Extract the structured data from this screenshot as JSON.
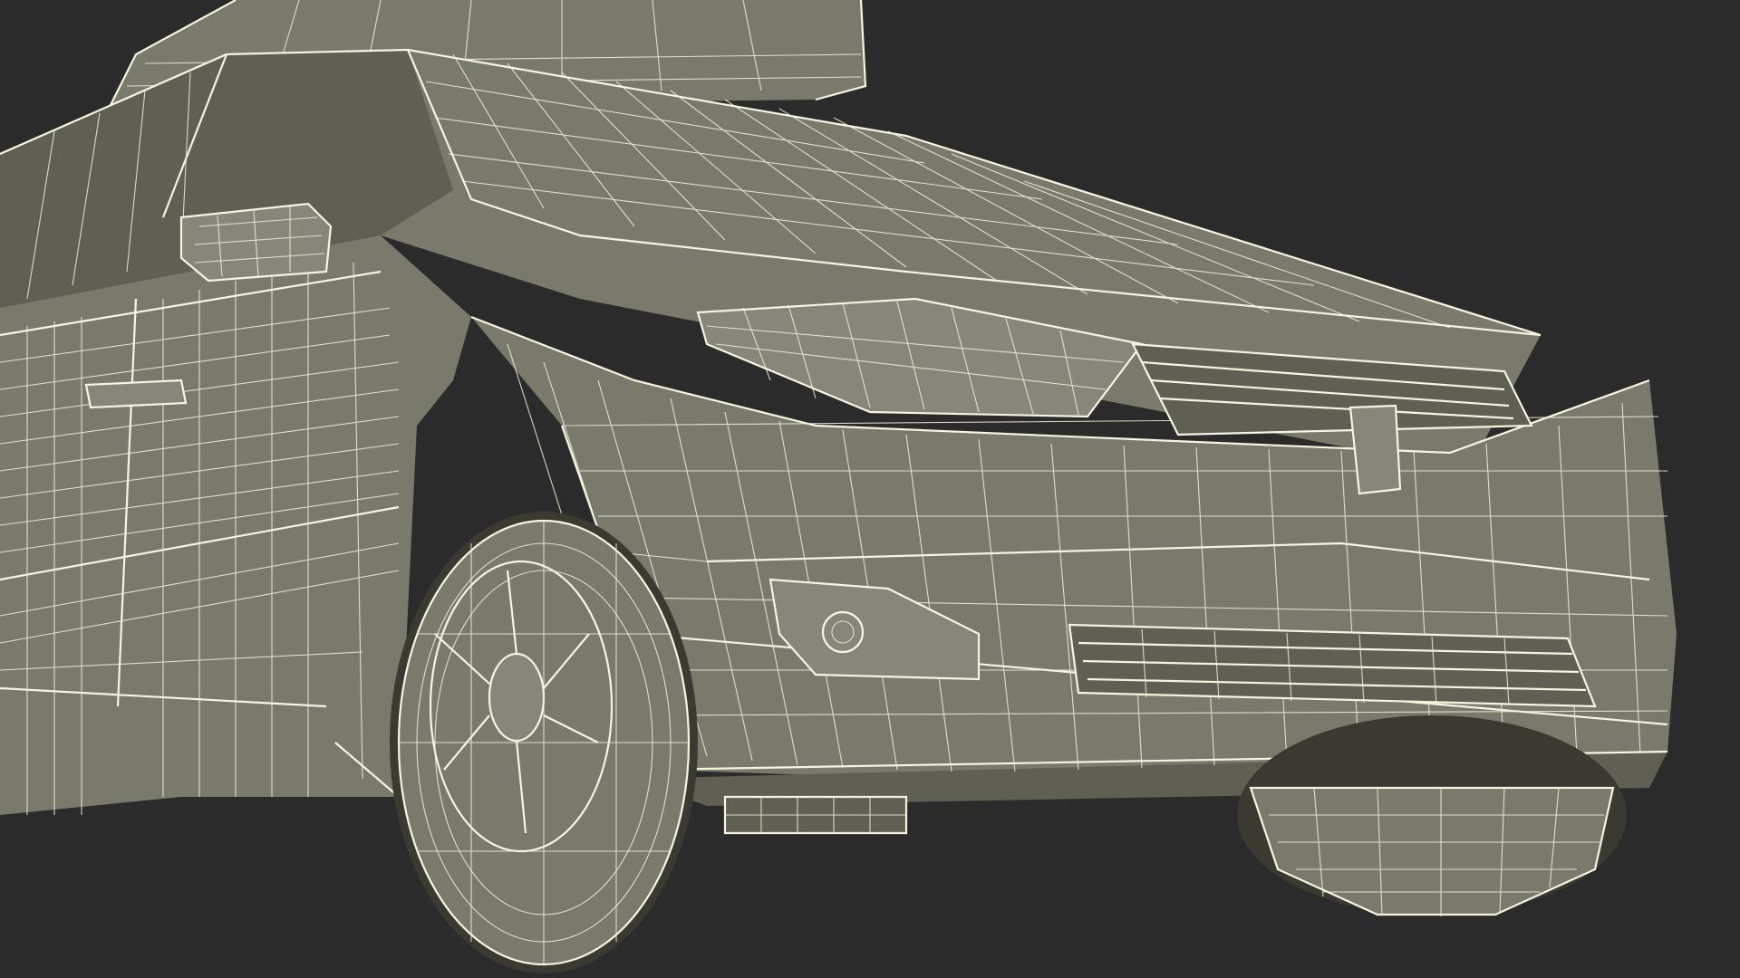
{
  "image": {
    "subject": "wireframe-car",
    "colors": {
      "background": "#2b2b2b",
      "surface": "#7a7a6c",
      "surface_dark": "#5f5f53",
      "wire": "#f2efd9"
    }
  }
}
